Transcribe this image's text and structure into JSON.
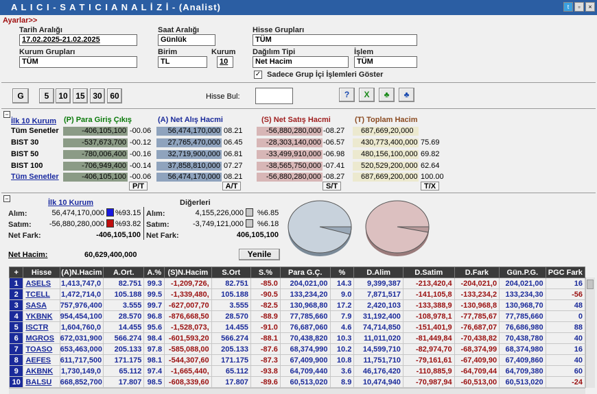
{
  "window": {
    "title": "A L I C I  -  S A T I C I   A N A L İ Z İ  -  (Analist)"
  },
  "settings": {
    "ayarlar": "Ayarlar>>",
    "tarih_label": "Tarih Aralığı",
    "tarih_value": "17.02.2025-21.02.2025",
    "saat_label": "Saat Aralığı",
    "saat_value": "Günlük",
    "hisse_grup_label": "Hisse Grupları",
    "hisse_grup_value": "TÜM",
    "kurum_grup_label": "Kurum Grupları",
    "kurum_grup_value": "TÜM",
    "birim_label": "Birim",
    "birim_value": "TL",
    "kurum_label": "Kurum",
    "kurum_value": "10",
    "dagilim_label": "Dağılım Tipi",
    "dagilim_value": "Net Hacim",
    "islem_label": "İşlem",
    "islem_value": "TÜM",
    "sadece_label": "Sadece Grup İçi İşlemleri Göster"
  },
  "toolbar": {
    "g": "G",
    "b5": "5",
    "b10": "10",
    "b15": "15",
    "b30": "30",
    "b60": "60",
    "hisse_bul": "Hisse Bul:"
  },
  "summary": {
    "ilk10": "İlk 10 Kurum",
    "hdr_p": "(P) Para Giriş Çıkış",
    "hdr_a": "(A) Net Alış Hacmi",
    "hdr_s": "(S) Net Satış Hacmi",
    "hdr_t": "(T) Toplam Hacim",
    "rows": [
      {
        "label": "Tüm Senetler",
        "p": "-406,105,100",
        "pp": "-00.06",
        "a": "56,474,170,000",
        "ap": "08.21",
        "s": "-56,880,280,000",
        "sp": "-08.27",
        "t": "687,669,20,000",
        "tp": ""
      },
      {
        "label": "BIST 30",
        "p": "-537,673,700",
        "pp": "-00.12",
        "a": "27,765,470,000",
        "ap": "06.45",
        "s": "-28,303,140,000",
        "sp": "-06.57",
        "t": "430,773,400,000",
        "tp": "75.69"
      },
      {
        "label": "BIST 50",
        "p": "-780,006,400",
        "pp": "-00.16",
        "a": "32,719,900,000",
        "ap": "06.81",
        "s": "-33,499,910,000",
        "sp": "-06.98",
        "t": "480,156,100,000",
        "tp": "69.82"
      },
      {
        "label": "BIST 100",
        "p": "-706,949,400",
        "pp": "-00.14",
        "a": "37,858,810,000",
        "ap": "07.27",
        "s": "-38,565,750,000",
        "sp": "-07.41",
        "t": "520,529,200,000",
        "tp": "62.64"
      },
      {
        "label": "Tüm Senetler",
        "p": "-406,105,100",
        "pp": "-00.06",
        "a": "56,474,170,000",
        "ap": "08.21",
        "s": "-56,880,280,000",
        "sp": "-08.27",
        "t": "687,669,200,000",
        "tp": "100.00"
      }
    ],
    "btn_pt": "P/T",
    "btn_at": "A/T",
    "btn_st": "S/T",
    "btn_tx": "T/X"
  },
  "kurum": {
    "ilk10": "İlk 10 Kurum",
    "digerleri": "Diğerleri",
    "alim_label": "Alım:",
    "satim_label": "Satım:",
    "netfark_label": "Net Fark:",
    "alim_value": "56,474,170,000",
    "alim_pct": "%93.15",
    "satim_value": "-56,880,280,000",
    "satim_pct": "%93.82",
    "netfark_value": "-406,105,100",
    "d_alim_value": "4,155,226,000",
    "d_alim_pct": "%6.85",
    "d_satim_value": "-3,749,121,000",
    "d_satim_pct": "%6.18",
    "d_netfark_value": "406,105,100",
    "net_hacim_label": "Net Hacim:",
    "net_hacim_value": "60,629,400,000",
    "yenile": "Yenile",
    "colors": {
      "alim": "#1a1ae0",
      "satim": "#c01010",
      "diger": "#c8c8c8"
    }
  },
  "grid": {
    "headers": [
      "+",
      "Hisse",
      "(A)N.Hacim",
      "A.Ort.",
      "A.%",
      "(S)N.Hacim",
      "S.Ort",
      "S.%",
      "Para G.Ç.",
      "%",
      "D.Alim",
      "D.Satim",
      "D.Fark",
      "Gün.P.G.",
      "PGC Fark"
    ],
    "rows": [
      [
        "1",
        "ASELS",
        "1,413,747,0",
        "82.751",
        "99.3",
        "-1,209,726,",
        "82.751",
        "-85.0",
        "204,021,00",
        "14.3",
        "9,399,387",
        "-213,420,4",
        "-204,021,0",
        "204,021,00",
        "16"
      ],
      [
        "2",
        "TCELL",
        "1,472,714,0",
        "105.188",
        "99.5",
        "-1,339,480,",
        "105.188",
        "-90.5",
        "133,234,20",
        "9.0",
        "7,871,517",
        "-141,105,8",
        "-133,234,2",
        "133,234,30",
        "-56"
      ],
      [
        "3",
        "SASA",
        "757,976,400",
        "3.555",
        "99.7",
        "-627,007,70",
        "3.555",
        "-82.5",
        "130,968,80",
        "17.2",
        "2,420,103",
        "-133,388,9",
        "-130,968,8",
        "130,968,70",
        "48"
      ],
      [
        "4",
        "YKBNK",
        "954,454,100",
        "28.570",
        "96.8",
        "-876,668,50",
        "28.570",
        "-88.9",
        "77,785,660",
        "7.9",
        "31,192,400",
        "-108,978,1",
        "-77,785,67",
        "77,785,660",
        "0"
      ],
      [
        "5",
        "ISCTR",
        "1,604,760,0",
        "14.455",
        "95.6",
        "-1,528,073,",
        "14.455",
        "-91.0",
        "76,687,060",
        "4.6",
        "74,714,850",
        "-151,401,9",
        "-76,687,07",
        "76,686,980",
        "88"
      ],
      [
        "6",
        "MGROS",
        "672,031,900",
        "566.274",
        "98.4",
        "-601,593,20",
        "566.274",
        "-88.1",
        "70,438,820",
        "10.3",
        "11,011,020",
        "-81,449,84",
        "-70,438,82",
        "70,438,780",
        "40"
      ],
      [
        "7",
        "TOASO",
        "653,463,000",
        "205.133",
        "97.8",
        "-585,088,00",
        "205.133",
        "-87.6",
        "68,374,990",
        "10.2",
        "14,599,710",
        "-82,974,70",
        "-68,374,99",
        "68,374,980",
        "16"
      ],
      [
        "8",
        "AEFES",
        "611,717,500",
        "171.175",
        "98.1",
        "-544,307,60",
        "171.175",
        "-87.3",
        "67,409,900",
        "10.8",
        "11,751,710",
        "-79,161,61",
        "-67,409,90",
        "67,409,860",
        "40"
      ],
      [
        "9",
        "AKBNK",
        "1,730,149,0",
        "65.112",
        "97.4",
        "-1,665,440,",
        "65.112",
        "-93.8",
        "64,709,440",
        "3.6",
        "46,176,420",
        "-110,885,9",
        "-64,709,44",
        "64,709,380",
        "60"
      ],
      [
        "10",
        "BALSU",
        "668,852,700",
        "17.807",
        "98.5",
        "-608,339,60",
        "17.807",
        "-89.6",
        "60,513,020",
        "8.9",
        "10,474,940",
        "-70,987,94",
        "-60,513,00",
        "60,513,020",
        "-24"
      ]
    ]
  }
}
